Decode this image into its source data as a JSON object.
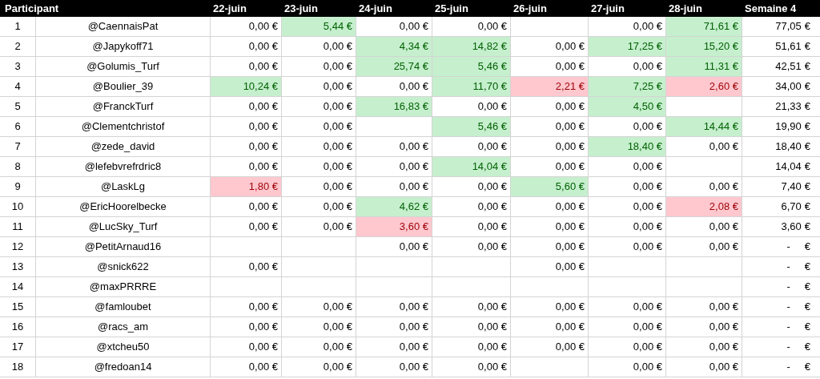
{
  "table": {
    "columns": [
      "Participant",
      "22-juin",
      "23-juin",
      "24-juin",
      "25-juin",
      "26-juin",
      "27-juin",
      "28-juin",
      "Semaine 4"
    ],
    "rows": [
      {
        "rank": "1",
        "name": "@CaennaisPat",
        "days": [
          {
            "value": "0,00 €",
            "gain": false,
            "loss": false
          },
          {
            "value": "5,44 €",
            "gain": true,
            "loss": false
          },
          {
            "value": "0,00 €",
            "gain": false,
            "loss": false
          },
          {
            "value": "0,00 €",
            "gain": false,
            "loss": false
          },
          {
            "blank": true
          },
          {
            "value": "0,00 €",
            "gain": false,
            "loss": false
          },
          {
            "value": "71,61 €",
            "gain": true,
            "loss": false
          }
        ],
        "total": {
          "kind": "amount",
          "amount": "77,05",
          "unit": "€"
        }
      },
      {
        "rank": "2",
        "name": "@Japykoff71",
        "days": [
          {
            "value": "0,00 €",
            "gain": false,
            "loss": false
          },
          {
            "value": "0,00 €",
            "gain": false,
            "loss": false
          },
          {
            "value": "4,34 €",
            "gain": true,
            "loss": false
          },
          {
            "value": "14,82 €",
            "gain": true,
            "loss": false
          },
          {
            "value": "0,00 €",
            "gain": false,
            "loss": false
          },
          {
            "value": "17,25 €",
            "gain": true,
            "loss": false
          },
          {
            "value": "15,20 €",
            "gain": true,
            "loss": false
          }
        ],
        "total": {
          "kind": "amount",
          "amount": "51,61",
          "unit": "€"
        }
      },
      {
        "rank": "3",
        "name": "@Golumis_Turf",
        "days": [
          {
            "value": "0,00 €",
            "gain": false,
            "loss": false
          },
          {
            "value": "0,00 €",
            "gain": false,
            "loss": false
          },
          {
            "value": "25,74 €",
            "gain": true,
            "loss": false
          },
          {
            "value": "5,46 €",
            "gain": true,
            "loss": false
          },
          {
            "value": "0,00 €",
            "gain": false,
            "loss": false
          },
          {
            "value": "0,00 €",
            "gain": false,
            "loss": false
          },
          {
            "value": "11,31 €",
            "gain": true,
            "loss": false
          }
        ],
        "total": {
          "kind": "amount",
          "amount": "42,51",
          "unit": "€"
        }
      },
      {
        "rank": "4",
        "name": "@Boulier_39",
        "days": [
          {
            "value": "10,24 €",
            "gain": true,
            "loss": false
          },
          {
            "value": "0,00 €",
            "gain": false,
            "loss": false
          },
          {
            "value": "0,00 €",
            "gain": false,
            "loss": false
          },
          {
            "value": "11,70 €",
            "gain": true,
            "loss": false
          },
          {
            "value": "2,21 €",
            "gain": false,
            "loss": true
          },
          {
            "value": "7,25 €",
            "gain": true,
            "loss": false
          },
          {
            "value": "2,60 €",
            "gain": false,
            "loss": true
          }
        ],
        "total": {
          "kind": "amount",
          "amount": "34,00",
          "unit": "€"
        }
      },
      {
        "rank": "5",
        "name": "@FranckTurf",
        "days": [
          {
            "value": "0,00 €",
            "gain": false,
            "loss": false
          },
          {
            "value": "0,00 €",
            "gain": false,
            "loss": false
          },
          {
            "value": "16,83 €",
            "gain": true,
            "loss": false
          },
          {
            "value": "0,00 €",
            "gain": false,
            "loss": false
          },
          {
            "value": "0,00 €",
            "gain": false,
            "loss": false
          },
          {
            "value": "4,50 €",
            "gain": true,
            "loss": false
          },
          {
            "blank": true
          }
        ],
        "total": {
          "kind": "amount",
          "amount": "21,33",
          "unit": "€"
        }
      },
      {
        "rank": "6",
        "name": "@Clementchristof",
        "days": [
          {
            "value": "0,00 €",
            "gain": false,
            "loss": false
          },
          {
            "value": "0,00 €",
            "gain": false,
            "loss": false
          },
          {
            "blank": true
          },
          {
            "value": "5,46 €",
            "gain": true,
            "loss": false
          },
          {
            "value": "0,00 €",
            "gain": false,
            "loss": false
          },
          {
            "value": "0,00 €",
            "gain": false,
            "loss": false
          },
          {
            "value": "14,44 €",
            "gain": true,
            "loss": false
          }
        ],
        "total": {
          "kind": "amount",
          "amount": "19,90",
          "unit": "€"
        }
      },
      {
        "rank": "7",
        "name": "@zede_david",
        "days": [
          {
            "value": "0,00 €",
            "gain": false,
            "loss": false
          },
          {
            "value": "0,00 €",
            "gain": false,
            "loss": false
          },
          {
            "value": "0,00 €",
            "gain": false,
            "loss": false
          },
          {
            "value": "0,00 €",
            "gain": false,
            "loss": false
          },
          {
            "value": "0,00 €",
            "gain": false,
            "loss": false
          },
          {
            "value": "18,40 €",
            "gain": true,
            "loss": false
          },
          {
            "value": "0,00 €",
            "gain": false,
            "loss": false
          }
        ],
        "total": {
          "kind": "amount",
          "amount": "18,40",
          "unit": "€"
        }
      },
      {
        "rank": "8",
        "name": "@lefebvrefrdric8",
        "days": [
          {
            "value": "0,00 €",
            "gain": false,
            "loss": false
          },
          {
            "value": "0,00 €",
            "gain": false,
            "loss": false
          },
          {
            "value": "0,00 €",
            "gain": false,
            "loss": false
          },
          {
            "value": "14,04 €",
            "gain": true,
            "loss": false
          },
          {
            "value": "0,00 €",
            "gain": false,
            "loss": false
          },
          {
            "value": "0,00 €",
            "gain": false,
            "loss": false
          },
          {
            "blank": true
          }
        ],
        "total": {
          "kind": "amount",
          "amount": "14,04",
          "unit": "€"
        }
      },
      {
        "rank": "9",
        "name": "@LaskLg",
        "days": [
          {
            "value": "1,80 €",
            "gain": false,
            "loss": true
          },
          {
            "value": "0,00 €",
            "gain": false,
            "loss": false
          },
          {
            "value": "0,00 €",
            "gain": false,
            "loss": false
          },
          {
            "value": "0,00 €",
            "gain": false,
            "loss": false
          },
          {
            "value": "5,60 €",
            "gain": true,
            "loss": false
          },
          {
            "value": "0,00 €",
            "gain": false,
            "loss": false
          },
          {
            "value": "0,00 €",
            "gain": false,
            "loss": false
          }
        ],
        "total": {
          "kind": "amount",
          "amount": "7,40",
          "unit": "€"
        }
      },
      {
        "rank": "10",
        "name": "@EricHoorelbecke",
        "days": [
          {
            "value": "0,00 €",
            "gain": false,
            "loss": false
          },
          {
            "value": "0,00 €",
            "gain": false,
            "loss": false
          },
          {
            "value": "4,62 €",
            "gain": true,
            "loss": false
          },
          {
            "value": "0,00 €",
            "gain": false,
            "loss": false
          },
          {
            "value": "0,00 €",
            "gain": false,
            "loss": false
          },
          {
            "value": "0,00 €",
            "gain": false,
            "loss": false
          },
          {
            "value": "2,08 €",
            "gain": false,
            "loss": true
          }
        ],
        "total": {
          "kind": "amount",
          "amount": "6,70",
          "unit": "€"
        }
      },
      {
        "rank": "11",
        "name": "@LucSky_Turf",
        "days": [
          {
            "value": "0,00 €",
            "gain": false,
            "loss": false
          },
          {
            "value": "0,00 €",
            "gain": false,
            "loss": false
          },
          {
            "value": "3,60 €",
            "gain": false,
            "loss": true
          },
          {
            "value": "0,00 €",
            "gain": false,
            "loss": false
          },
          {
            "value": "0,00 €",
            "gain": false,
            "loss": false
          },
          {
            "value": "0,00 €",
            "gain": false,
            "loss": false
          },
          {
            "value": "0,00 €",
            "gain": false,
            "loss": false
          }
        ],
        "total": {
          "kind": "amount",
          "amount": "3,60",
          "unit": "€"
        }
      },
      {
        "rank": "12",
        "name": "@PetitArnaud16",
        "days": [
          {
            "blank": true
          },
          {
            "blank": true
          },
          {
            "value": "0,00 €",
            "gain": false,
            "loss": false
          },
          {
            "value": "0,00 €",
            "gain": false,
            "loss": false
          },
          {
            "value": "0,00 €",
            "gain": false,
            "loss": false
          },
          {
            "value": "0,00 €",
            "gain": false,
            "loss": false
          },
          {
            "value": "0,00 €",
            "gain": false,
            "loss": false
          }
        ],
        "total": {
          "kind": "dash",
          "amount": "-",
          "unit": "€"
        }
      },
      {
        "rank": "13",
        "name": "@snick622",
        "days": [
          {
            "value": "0,00 €",
            "gain": false,
            "loss": false
          },
          {
            "blank": true
          },
          {
            "blank": true
          },
          {
            "blank": true
          },
          {
            "value": "0,00 €",
            "gain": false,
            "loss": false
          },
          {
            "blank": true
          },
          {
            "blank": true
          }
        ],
        "total": {
          "kind": "dash",
          "amount": "-",
          "unit": "€"
        }
      },
      {
        "rank": "14",
        "name": "@maxPRRRE",
        "days": [
          {
            "blank": true
          },
          {
            "blank": true
          },
          {
            "blank": true
          },
          {
            "blank": true
          },
          {
            "blank": true
          },
          {
            "blank": true
          },
          {
            "blank": true
          }
        ],
        "total": {
          "kind": "dash",
          "amount": "-",
          "unit": "€"
        }
      },
      {
        "rank": "15",
        "name": "@famloubet",
        "days": [
          {
            "value": "0,00 €",
            "gain": false,
            "loss": false
          },
          {
            "value": "0,00 €",
            "gain": false,
            "loss": false
          },
          {
            "value": "0,00 €",
            "gain": false,
            "loss": false
          },
          {
            "value": "0,00 €",
            "gain": false,
            "loss": false
          },
          {
            "value": "0,00 €",
            "gain": false,
            "loss": false
          },
          {
            "value": "0,00 €",
            "gain": false,
            "loss": false
          },
          {
            "value": "0,00 €",
            "gain": false,
            "loss": false
          }
        ],
        "total": {
          "kind": "dash",
          "amount": "-",
          "unit": "€"
        }
      },
      {
        "rank": "16",
        "name": "@racs_am",
        "days": [
          {
            "value": "0,00 €",
            "gain": false,
            "loss": false
          },
          {
            "value": "0,00 €",
            "gain": false,
            "loss": false
          },
          {
            "value": "0,00 €",
            "gain": false,
            "loss": false
          },
          {
            "value": "0,00 €",
            "gain": false,
            "loss": false
          },
          {
            "value": "0,00 €",
            "gain": false,
            "loss": false
          },
          {
            "value": "0,00 €",
            "gain": false,
            "loss": false
          },
          {
            "value": "0,00 €",
            "gain": false,
            "loss": false
          }
        ],
        "total": {
          "kind": "dash",
          "amount": "-",
          "unit": "€"
        }
      },
      {
        "rank": "17",
        "name": "@xtcheu50",
        "days": [
          {
            "value": "0,00 €",
            "gain": false,
            "loss": false
          },
          {
            "value": "0,00 €",
            "gain": false,
            "loss": false
          },
          {
            "value": "0,00 €",
            "gain": false,
            "loss": false
          },
          {
            "value": "0,00 €",
            "gain": false,
            "loss": false
          },
          {
            "value": "0,00 €",
            "gain": false,
            "loss": false
          },
          {
            "value": "0,00 €",
            "gain": false,
            "loss": false
          },
          {
            "value": "0,00 €",
            "gain": false,
            "loss": false
          }
        ],
        "total": {
          "kind": "dash",
          "amount": "-",
          "unit": "€"
        }
      },
      {
        "rank": "18",
        "name": "@fredoan14",
        "days": [
          {
            "value": "0,00 €",
            "gain": false,
            "loss": false
          },
          {
            "value": "0,00 €",
            "gain": false,
            "loss": false
          },
          {
            "value": "0,00 €",
            "gain": false,
            "loss": false
          },
          {
            "value": "0,00 €",
            "gain": false,
            "loss": false
          },
          {
            "blank": true
          },
          {
            "value": "0,00 €",
            "gain": false,
            "loss": false
          },
          {
            "value": "0,00 €",
            "gain": false,
            "loss": false
          }
        ],
        "total": {
          "kind": "dash",
          "amount": "-",
          "unit": "€"
        }
      }
    ]
  }
}
